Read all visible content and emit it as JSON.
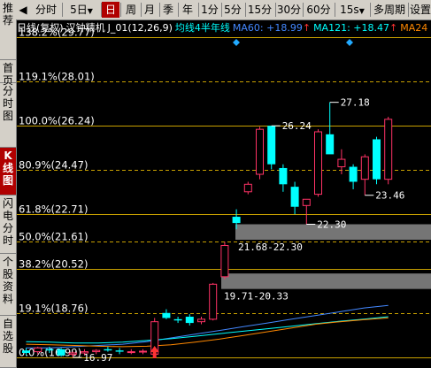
{
  "left_nav": [
    {
      "label": "推荐",
      "active": false
    },
    {
      "label": "首页",
      "active": false
    },
    {
      "label": "分时图",
      "active": false
    },
    {
      "label": "K线图",
      "active": true
    },
    {
      "label": "闪电分时",
      "active": false
    },
    {
      "label": "个股资料",
      "active": false
    },
    {
      "label": "自选股",
      "active": false
    }
  ],
  "toolbar": {
    "first_arrow": "◀",
    "periods": [
      "分时",
      "5日",
      "日",
      "周",
      "月",
      "季",
      "年",
      "1分",
      "5分",
      "15分",
      "30分",
      "60分",
      "15s",
      "多周期",
      "设置"
    ],
    "active_period": "日",
    "dropdown_arrow": "▼",
    "fiveday_arrow": "▼"
  },
  "title": {
    "daily": "日线(复权)",
    "name": "汉钟精机",
    "indicator": "J_01(12,26,9)",
    "ma_label": "均线4半年线",
    "ma60": "MA60: +18.99",
    "ma60_arrow": "↑",
    "ma121": "MA121: +18.47",
    "ma121_arrow": "↑",
    "ma24": "MA24"
  },
  "colors": {
    "up": "#ff3366",
    "down": "#00ffff",
    "level_line": "#c8a000",
    "ma60": "#4488ff",
    "ma121": "#00ffff",
    "ma24": "#ff8800",
    "zone": "#8a8a8a",
    "arrow": "#ff3333"
  },
  "fib_levels": [
    {
      "label": "138.2%(29.77)",
      "price": 29.77,
      "style": "solid"
    },
    {
      "label": "119.1%(28.01)",
      "price": 28.01,
      "style": "dashed"
    },
    {
      "label": "100.0%(26.24)",
      "price": 26.24,
      "style": "solid"
    },
    {
      "label": "80.9%(24.47)",
      "price": 24.47,
      "style": "dashed"
    },
    {
      "label": "61.8%(22.71)",
      "price": 22.71,
      "style": "solid"
    },
    {
      "label": "50.0%(21.61)",
      "price": 21.61,
      "style": "dashed"
    },
    {
      "label": "38.2%(20.52)",
      "price": 20.52,
      "style": "solid"
    },
    {
      "label": "19.1%(18.76)",
      "price": 18.76,
      "style": "dashed"
    },
    {
      "label": "0.0%(16.99)",
      "price": 16.99,
      "style": "solid"
    }
  ],
  "zones": [
    {
      "label": "21.68-22.30",
      "low": 21.68,
      "high": 22.3
    },
    {
      "label": "19.71-20.33",
      "low": 19.71,
      "high": 20.33
    }
  ],
  "annotations": [
    {
      "label": "27.18",
      "price": 27.18
    },
    {
      "label": "26.24",
      "price": 26.24
    },
    {
      "label": "23.46",
      "price": 23.46
    },
    {
      "label": "22.30",
      "price": 22.3
    },
    {
      "label": "16.97",
      "price": 16.97
    }
  ],
  "candles": [
    {
      "o": 17.25,
      "h": 17.35,
      "l": 17.05,
      "c": 17.15
    },
    {
      "o": 17.2,
      "h": 17.4,
      "l": 17.1,
      "c": 17.35
    },
    {
      "o": 17.3,
      "h": 17.4,
      "l": 17.15,
      "c": 17.25
    },
    {
      "o": 17.3,
      "h": 17.35,
      "l": 17.0,
      "c": 17.05
    },
    {
      "o": 17.1,
      "h": 17.2,
      "l": 16.97,
      "c": 17.15
    },
    {
      "o": 17.15,
      "h": 17.3,
      "l": 17.05,
      "c": 17.2
    },
    {
      "o": 17.2,
      "h": 17.3,
      "l": 17.1,
      "c": 17.25
    },
    {
      "o": 17.3,
      "h": 17.4,
      "l": 17.2,
      "c": 17.25
    },
    {
      "o": 17.25,
      "h": 17.35,
      "l": 17.1,
      "c": 17.2
    },
    {
      "o": 17.2,
      "h": 17.3,
      "l": 17.1,
      "c": 17.2
    },
    {
      "o": 17.2,
      "h": 17.3,
      "l": 17.1,
      "c": 17.22
    },
    {
      "o": 17.1,
      "h": 18.55,
      "l": 17.05,
      "c": 18.4
    },
    {
      "o": 18.75,
      "h": 18.9,
      "l": 18.5,
      "c": 18.55
    },
    {
      "o": 18.5,
      "h": 18.6,
      "l": 18.35,
      "c": 18.45
    },
    {
      "o": 18.6,
      "h": 18.7,
      "l": 18.25,
      "c": 18.35
    },
    {
      "o": 18.4,
      "h": 18.6,
      "l": 18.3,
      "c": 18.5
    },
    {
      "o": 18.5,
      "h": 19.95,
      "l": 18.45,
      "c": 19.9
    },
    {
      "o": 20.2,
      "h": 21.6,
      "l": 20.1,
      "c": 21.45
    },
    {
      "o": 22.6,
      "h": 22.9,
      "l": 22.1,
      "c": 22.35
    },
    {
      "o": 23.6,
      "h": 24.0,
      "l": 23.5,
      "c": 23.9
    },
    {
      "o": 24.3,
      "h": 26.2,
      "l": 24.1,
      "c": 26.1
    },
    {
      "o": 26.24,
      "h": 26.24,
      "l": 24.5,
      "c": 24.7
    },
    {
      "o": 24.55,
      "h": 24.7,
      "l": 23.6,
      "c": 23.9
    },
    {
      "o": 23.8,
      "h": 24.0,
      "l": 22.7,
      "c": 23.0
    },
    {
      "o": 23.05,
      "h": 23.3,
      "l": 22.3,
      "c": 23.3
    },
    {
      "o": 23.5,
      "h": 26.1,
      "l": 23.4,
      "c": 26.0
    },
    {
      "o": 25.9,
      "h": 27.18,
      "l": 25.5,
      "c": 25.1
    },
    {
      "o": 24.6,
      "h": 25.3,
      "l": 24.3,
      "c": 24.9
    },
    {
      "o": 24.6,
      "h": 24.7,
      "l": 23.7,
      "c": 24.0
    },
    {
      "o": 24.1,
      "h": 25.1,
      "l": 23.46,
      "c": 25.0
    },
    {
      "o": 25.7,
      "h": 25.8,
      "l": 23.9,
      "c": 24.1
    },
    {
      "o": 24.1,
      "h": 26.6,
      "l": 23.9,
      "c": 26.5
    }
  ],
  "moving_averages": [
    {
      "name": "MA60",
      "color": "#4488ff",
      "points": [
        17.35,
        17.35,
        17.4,
        17.45,
        17.5,
        17.6,
        17.75,
        17.9,
        18.05,
        18.2,
        18.35,
        18.5,
        18.65,
        18.8,
        18.95,
        19.05
      ]
    },
    {
      "name": "MA121",
      "color": "#00ffff",
      "points": [
        17.6,
        17.58,
        17.55,
        17.55,
        17.58,
        17.65,
        17.72,
        17.82,
        17.92,
        18.02,
        18.12,
        18.22,
        18.32,
        18.42,
        18.5,
        18.6
      ]
    },
    {
      "name": "MA24",
      "color": "#ff8800",
      "points": [
        17.5,
        17.48,
        17.45,
        17.42,
        17.4,
        17.42,
        17.48,
        17.58,
        17.7,
        17.85,
        18.0,
        18.15,
        18.3,
        18.4,
        18.48,
        18.55
      ]
    }
  ]
}
